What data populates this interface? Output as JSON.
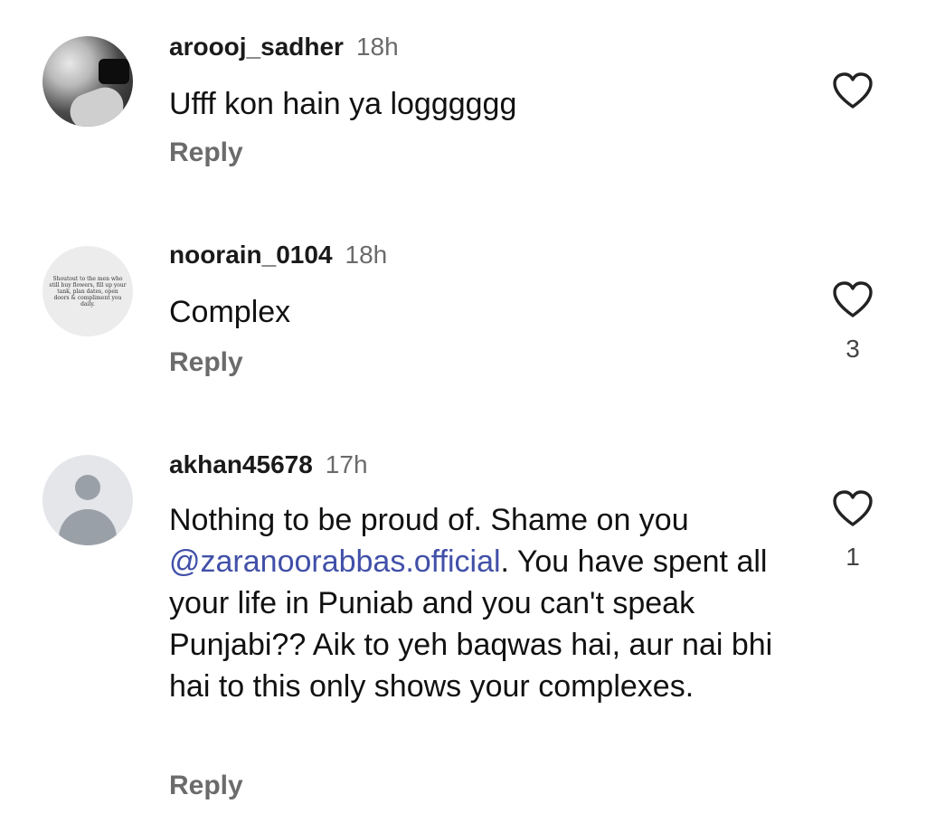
{
  "comments": [
    {
      "username": "aroooj_sadher",
      "time": "18h",
      "text": "Ufff kon hain ya logggggg",
      "reply_label": "Reply",
      "likes": ""
    },
    {
      "username": "noorain_0104",
      "time": "18h",
      "text": "Complex",
      "reply_label": "Reply",
      "likes": "3",
      "avatar_text": "Shoutout to the men who still buy flowers, fill up your tank, plan dates, open doors & compliment you daily."
    },
    {
      "username": "akhan45678",
      "time": "17h",
      "text_before": "Nothing to be proud of. Shame on you ",
      "mention": "@zaranoorabbas.official",
      "text_after": ". You have spent all your life in Puniab and you can't speak Punjabi?? Aik to yeh baqwas hai, aur nai bhi hai to this only shows your complexes.",
      "reply_label": "Reply",
      "likes": "1"
    }
  ],
  "icons": {
    "like": "heart-outline-icon",
    "avatar_default": "default-user-icon"
  },
  "colors": {
    "mention": "#4150a8",
    "secondary_text": "#6b6b6b"
  }
}
